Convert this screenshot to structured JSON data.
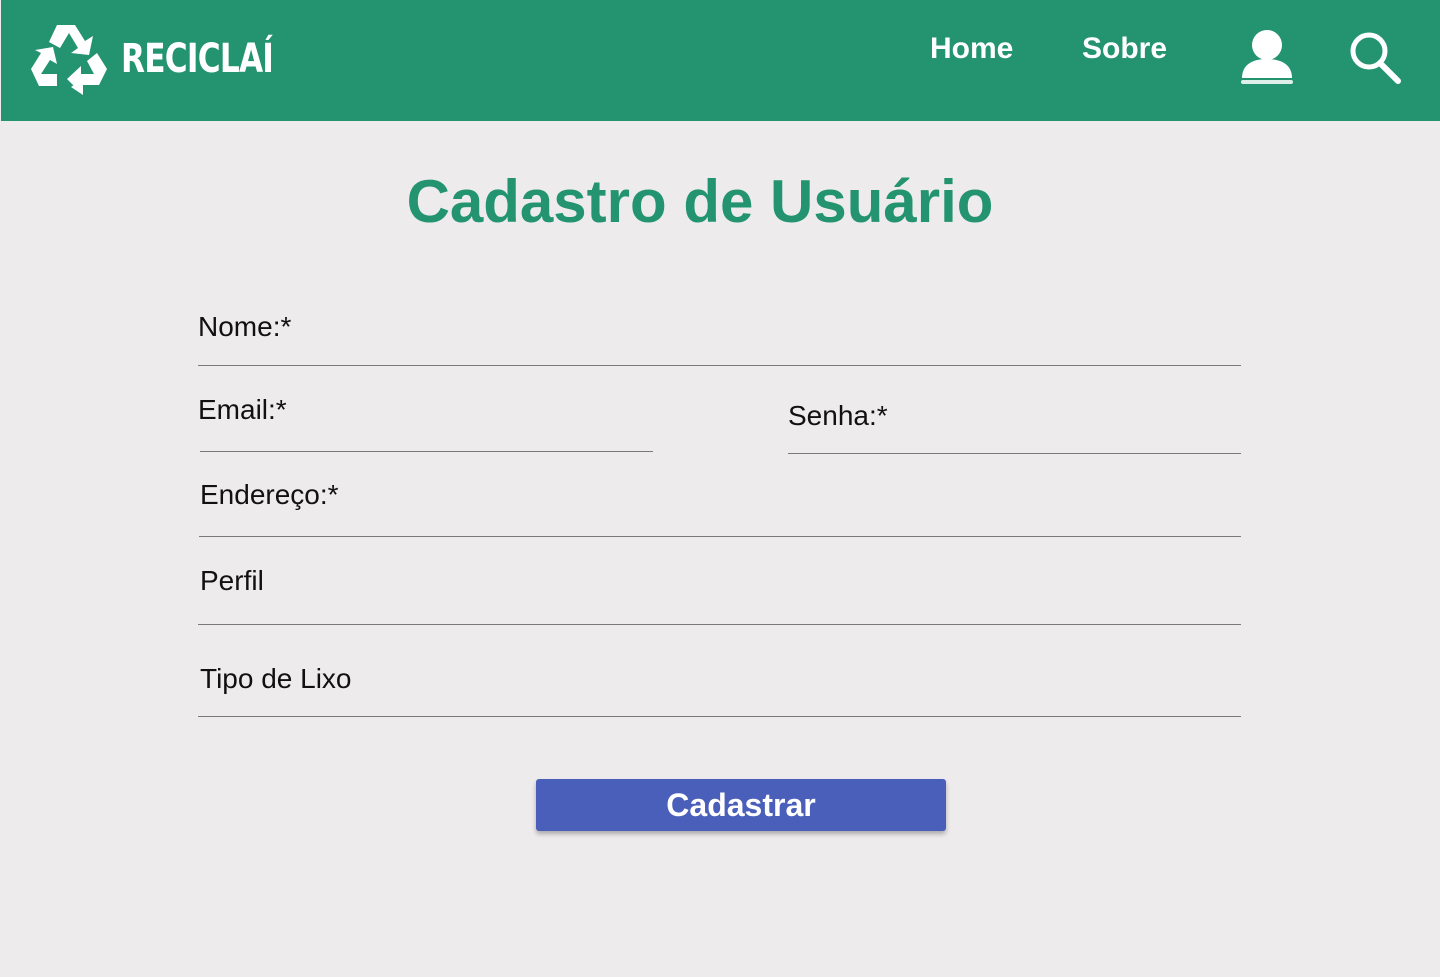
{
  "header": {
    "brand_name": "RECICLAÍ",
    "nav": {
      "home_label": "Home",
      "about_label": "Sobre"
    },
    "icons": {
      "logo": "recycle-icon",
      "user": "user-icon",
      "search": "search-icon"
    }
  },
  "main": {
    "title": "Cadastro de Usuário",
    "form": {
      "nome_label": "Nome:*",
      "email_label": "Email:*",
      "senha_label": "Senha:*",
      "endereco_label": "Endereço:*",
      "perfil_label": "Perfil",
      "tipo_lixo_label": "Tipo de Lixo",
      "submit_label": "Cadastrar"
    }
  },
  "colors": {
    "brand_green": "#23946f",
    "background": "#edebec",
    "button_blue": "#4a5fba",
    "text": "#111111",
    "white": "#ffffff"
  }
}
